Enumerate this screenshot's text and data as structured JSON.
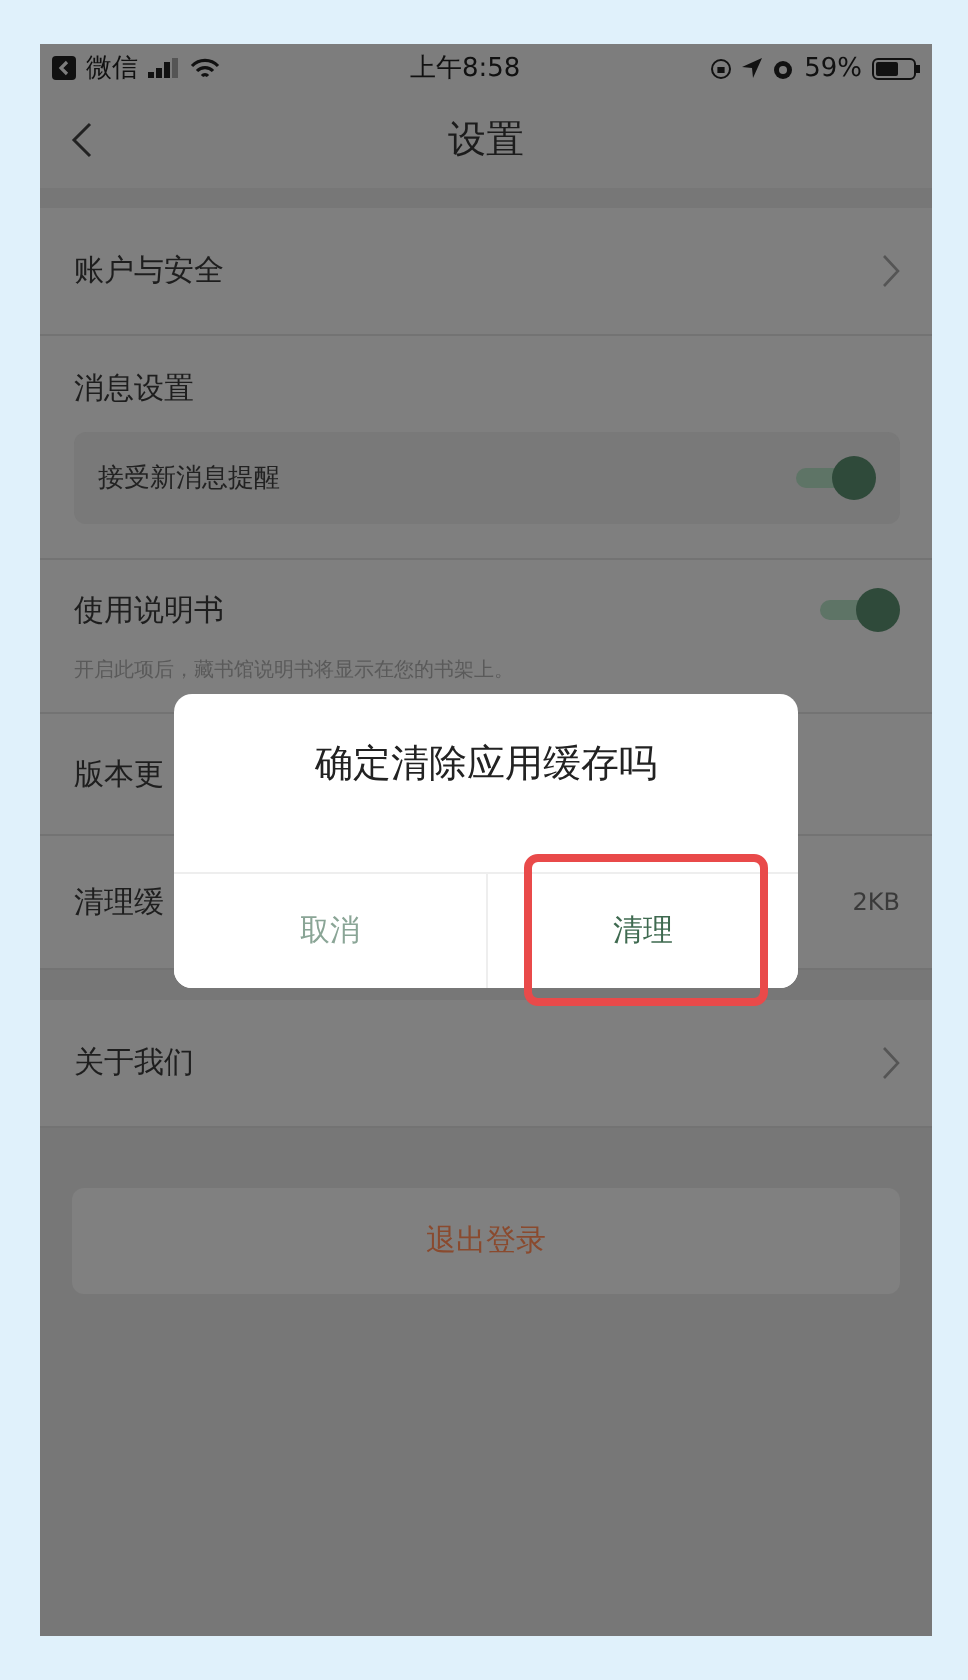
{
  "status_bar": {
    "back_app": "微信",
    "time": "上午8:58",
    "battery": "59%"
  },
  "nav": {
    "title": "设置"
  },
  "sections": [
    {
      "items": [
        {
          "kind": "link",
          "label": "账户与安全"
        },
        {
          "kind": "group",
          "label": "消息设置",
          "children": [
            {
              "label": "接受新消息提醒",
              "on": true
            }
          ]
        },
        {
          "kind": "toggle",
          "label": "使用说明书",
          "description": "开启此项后，藏书馆说明书将显示在您的书架上。",
          "on": true
        },
        {
          "kind": "plain",
          "label": "版本更"
        },
        {
          "kind": "value",
          "label": "清理缓",
          "value": "2KB"
        }
      ]
    },
    {
      "items": [
        {
          "kind": "link",
          "label": "关于我们"
        }
      ]
    }
  ],
  "logout_button": "退出登录",
  "dialog": {
    "title": "确定清除应用缓存吗",
    "buttons": [
      {
        "kind": "cancel",
        "label": "取消",
        "highlighted": false
      },
      {
        "kind": "confirm",
        "label": "清理",
        "highlighted": true
      }
    ]
  }
}
